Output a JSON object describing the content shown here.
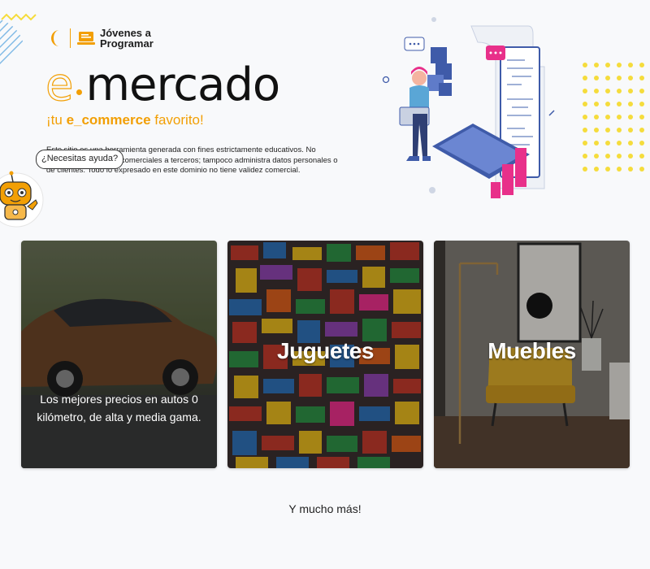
{
  "brand": {
    "line1": "Jóvenes a",
    "line2": "Programar"
  },
  "hero": {
    "title_prefix": "e",
    "title_main": "mercado",
    "tagline_start": "¡tu ",
    "tagline_bold": "e_commerce",
    "tagline_end": " favorito!",
    "disclaimer": "Este sitio es una herramienta generada con fines estrictamente educativos. No realiza transacciones comerciales a terceros; tampoco administra datos personales o de clientes. Todo lo expresado en este dominio no tiene validez comercial."
  },
  "help": {
    "label": "¿Necesitas ayuda?"
  },
  "cards": [
    {
      "caption": "Los mejores precios en autos 0 kilómetro, de alta y media gama."
    },
    {
      "caption": "Juguetes"
    },
    {
      "caption": "Muebles"
    }
  ],
  "footer": {
    "more": "Y mucho más!"
  },
  "colors": {
    "accent": "#f29f05",
    "background": "#f8f9fb",
    "illustration_blue": "#3f5ba9",
    "illustration_pink": "#e8308a",
    "dots_yellow": "#f5dc3c"
  }
}
